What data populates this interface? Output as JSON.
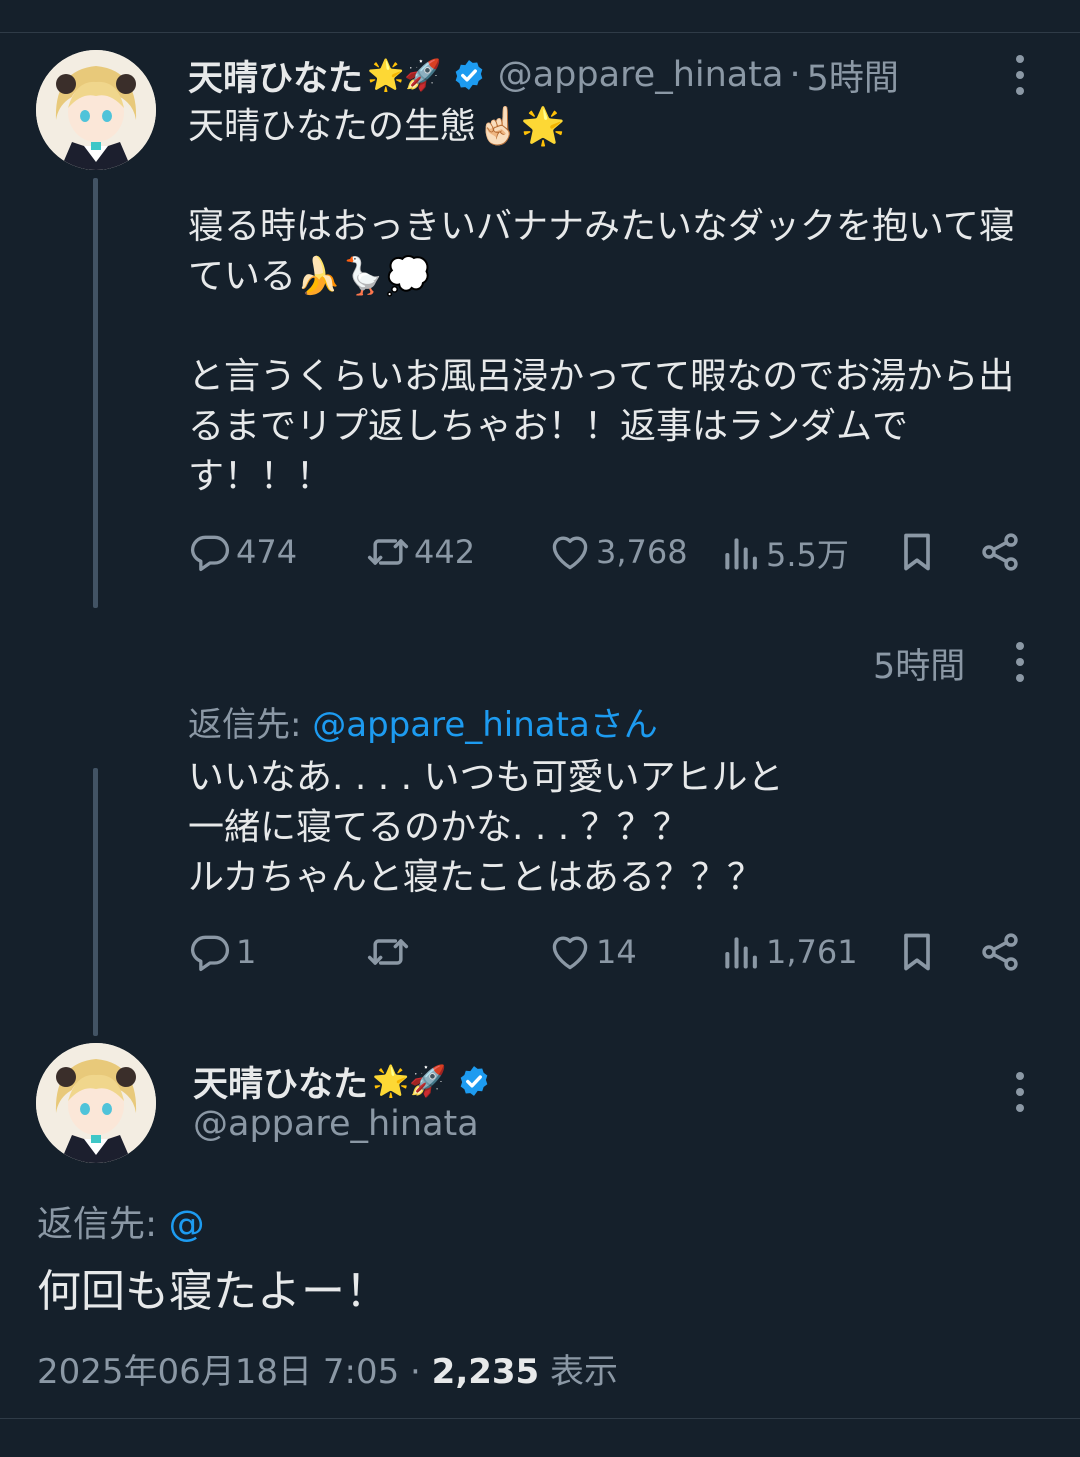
{
  "tweet1": {
    "display_name": "天晴ひなた",
    "name_emojis": "🌟🚀",
    "handle": "@appare_hinata",
    "separator": "·",
    "time": "5時間",
    "text": "天晴ひなたの生態☝🏻🌟\n\n寝る時はおっきいバナナみたいなダックを抱いて寝ている🍌🪿💭\n\nと言うくらいお風呂浸かってて暇なのでお湯から出るまでリプ返しちゃお！！返事はランダムです！！！",
    "stats": {
      "replies": "474",
      "retweets": "442",
      "likes": "3,768",
      "views": "5.5万"
    }
  },
  "tweet2": {
    "time": "5時間",
    "reply_label": "返信先: ",
    "reply_mention": "@appare_hinataさん",
    "text": "いいなあ. . . . いつも可愛いアヒルと\n一緒に寝てるのかな. . . ？？？\nルカちゃんと寝たことはある？？？",
    "stats": {
      "replies": "1",
      "retweets": "",
      "likes": "14",
      "views": "1,761"
    }
  },
  "tweet3": {
    "display_name": "天晴ひなた",
    "name_emojis": "🌟🚀",
    "handle": "@appare_hinata",
    "reply_label": "返信先: ",
    "reply_mention": "@",
    "text": "何回も寝たよー！",
    "timestamp": "2025年06月18日 7:05",
    "separator": "·",
    "views_count": "2,235",
    "views_label": "表示"
  },
  "colors": {
    "background": "#15202b",
    "accent": "#1d9bf0",
    "muted": "#8b98a5",
    "text": "#e7e9ea"
  }
}
